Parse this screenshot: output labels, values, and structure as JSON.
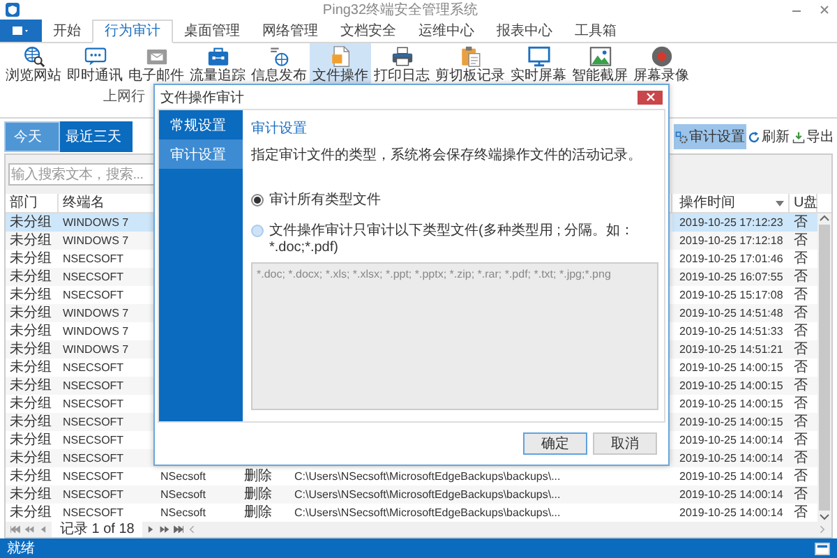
{
  "window": {
    "title": "Ping32终端安全管理系统"
  },
  "tabs": [
    {
      "label": "开始",
      "selected": false
    },
    {
      "label": "行为审计",
      "selected": true
    },
    {
      "label": "桌面管理",
      "selected": false
    },
    {
      "label": "网络管理",
      "selected": false
    },
    {
      "label": "文档安全",
      "selected": false
    },
    {
      "label": "运维中心",
      "selected": false
    },
    {
      "label": "报表中心",
      "selected": false
    },
    {
      "label": "工具箱",
      "selected": false
    }
  ],
  "ribbon": {
    "buttons": [
      {
        "label": "浏览网站",
        "selected": false
      },
      {
        "label": "即时通讯",
        "selected": false
      },
      {
        "label": "电子邮件",
        "selected": false
      },
      {
        "label": "流量追踪",
        "selected": false
      },
      {
        "label": "信息发布",
        "selected": false
      },
      {
        "label": "文件操作",
        "selected": true
      },
      {
        "label": "打印日志",
        "selected": false
      },
      {
        "label": "剪切板记录",
        "selected": false
      },
      {
        "label": "实时屏幕",
        "selected": false
      },
      {
        "label": "智能截屏",
        "selected": false
      },
      {
        "label": "屏幕录像",
        "selected": false
      }
    ],
    "group_label": "上网行"
  },
  "range_tabs": [
    {
      "label": "今天",
      "selected": true
    },
    {
      "label": "最近三天",
      "selected": false
    }
  ],
  "toolbar": [
    {
      "label": "审计设置",
      "selected": true
    },
    {
      "label": "刷新",
      "selected": false
    },
    {
      "label": "导出",
      "selected": false
    }
  ],
  "search": {
    "placeholder": "输入搜索文本，搜索..."
  },
  "table": {
    "columns": [
      {
        "label": "部门"
      },
      {
        "label": "终端名"
      },
      {
        "label": "操作时间"
      },
      {
        "label": "U盘"
      }
    ],
    "rows": [
      {
        "dept": "未分组",
        "terminal": "WINDOWS 7",
        "time": "2019-10-25 17:12:23",
        "usb": "否",
        "selected": true
      },
      {
        "dept": "未分组",
        "terminal": "WINDOWS 7",
        "time": "2019-10-25 17:12:18",
        "usb": "否",
        "selected": false
      },
      {
        "dept": "未分组",
        "terminal": "NSECSOFT",
        "time": "2019-10-25 17:01:46",
        "usb": "否",
        "selected": false
      },
      {
        "dept": "未分组",
        "terminal": "NSECSOFT",
        "time": "2019-10-25 16:07:55",
        "usb": "否",
        "selected": false
      },
      {
        "dept": "未分组",
        "terminal": "NSECSOFT",
        "time": "2019-10-25 15:17:08",
        "usb": "否",
        "selected": false
      },
      {
        "dept": "未分组",
        "terminal": "WINDOWS 7",
        "time": "2019-10-25 14:51:48",
        "usb": "否",
        "selected": false
      },
      {
        "dept": "未分组",
        "terminal": "WINDOWS 7",
        "time": "2019-10-25 14:51:33",
        "usb": "否",
        "selected": false
      },
      {
        "dept": "未分组",
        "terminal": "WINDOWS 7",
        "time": "2019-10-25 14:51:21",
        "usb": "否",
        "selected": false
      },
      {
        "dept": "未分组",
        "terminal": "NSECSOFT",
        "time": "2019-10-25 14:00:15",
        "usb": "否",
        "selected": false
      },
      {
        "dept": "未分组",
        "terminal": "NSECSOFT",
        "time": "2019-10-25 14:00:15",
        "usb": "否",
        "selected": false
      },
      {
        "dept": "未分组",
        "terminal": "NSECSOFT",
        "time": "2019-10-25 14:00:15",
        "usb": "否",
        "selected": false
      },
      {
        "dept": "未分组",
        "terminal": "NSECSOFT",
        "time": "2019-10-25 14:00:15",
        "usb": "否",
        "selected": false
      },
      {
        "dept": "未分组",
        "terminal": "NSECSOFT",
        "time": "2019-10-25 14:00:14",
        "usb": "否",
        "selected": false
      },
      {
        "dept": "未分组",
        "terminal": "NSECSOFT",
        "time": "2019-10-25 14:00:14",
        "usb": "否",
        "selected": false
      },
      {
        "dept": "未分组",
        "terminal": "NSECSOFT",
        "user": "NSecsoft",
        "action": "删除",
        "path": "C:\\Users\\NSecsoft\\MicrosoftEdgeBackups\\backups\\...",
        "time": "2019-10-25 14:00:14",
        "usb": "否",
        "selected": false
      },
      {
        "dept": "未分组",
        "terminal": "NSECSOFT",
        "user": "NSecsoft",
        "action": "删除",
        "path": "C:\\Users\\NSecsoft\\MicrosoftEdgeBackups\\backups\\...",
        "time": "2019-10-25 14:00:14",
        "usb": "否",
        "selected": false
      },
      {
        "dept": "未分组",
        "terminal": "NSECSOFT",
        "user": "NSecsoft",
        "action": "删除",
        "path": "C:\\Users\\NSecsoft\\MicrosoftEdgeBackups\\backups\\...",
        "time": "2019-10-25 14:00:14",
        "usb": "否",
        "selected": false
      }
    ]
  },
  "pager": {
    "text": "记录 1 of 18"
  },
  "status_bar": {
    "text": "就绪"
  },
  "dialog": {
    "title": "文件操作审计",
    "nav": [
      {
        "label": "常规设置",
        "selected": false
      },
      {
        "label": "审计设置",
        "selected": true
      }
    ],
    "section_title": "审计设置",
    "description": "指定审计文件的类型，系统将会保存终端操作文件的活动记录。",
    "options": [
      {
        "label": "审计所有类型文件",
        "selected": true
      },
      {
        "label": "文件操作审计只审计以下类型文件(多种类型用 ; 分隔。如：*.doc;*.pdf)",
        "selected": false
      }
    ],
    "file_types": {
      "value": "*.doc; *.docx; *.xls; *.xlsx; *.ppt; *.pptx; *.zip; *.rar; *.pdf; *.txt; *.jpg;*.png",
      "disabled": true
    },
    "buttons": [
      {
        "label": "确定",
        "default": true
      },
      {
        "label": "取消",
        "default": false
      }
    ]
  }
}
